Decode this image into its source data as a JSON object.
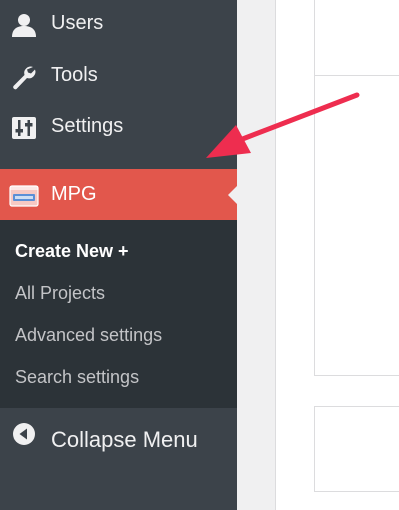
{
  "sidebar": {
    "items": [
      {
        "label": "Users",
        "icon": "user-icon"
      },
      {
        "label": "Tools",
        "icon": "wrench-icon"
      },
      {
        "label": "Settings",
        "icon": "sliders-icon"
      },
      {
        "label": "MPG",
        "icon": "mpg-logo-icon"
      }
    ],
    "submenu": [
      {
        "label": "Create New +"
      },
      {
        "label": "All Projects"
      },
      {
        "label": "Advanced settings"
      },
      {
        "label": "Search settings"
      }
    ],
    "collapse": {
      "label": "Collapse Menu",
      "icon": "collapse-arrow-icon"
    }
  },
  "colors": {
    "sidebar_bg": "#3c434a",
    "submenu_bg": "#2c3338",
    "active_accent": "#e2574c",
    "annotation_arrow": "#ee2d4f",
    "menu_text": "#f0f0f1"
  }
}
